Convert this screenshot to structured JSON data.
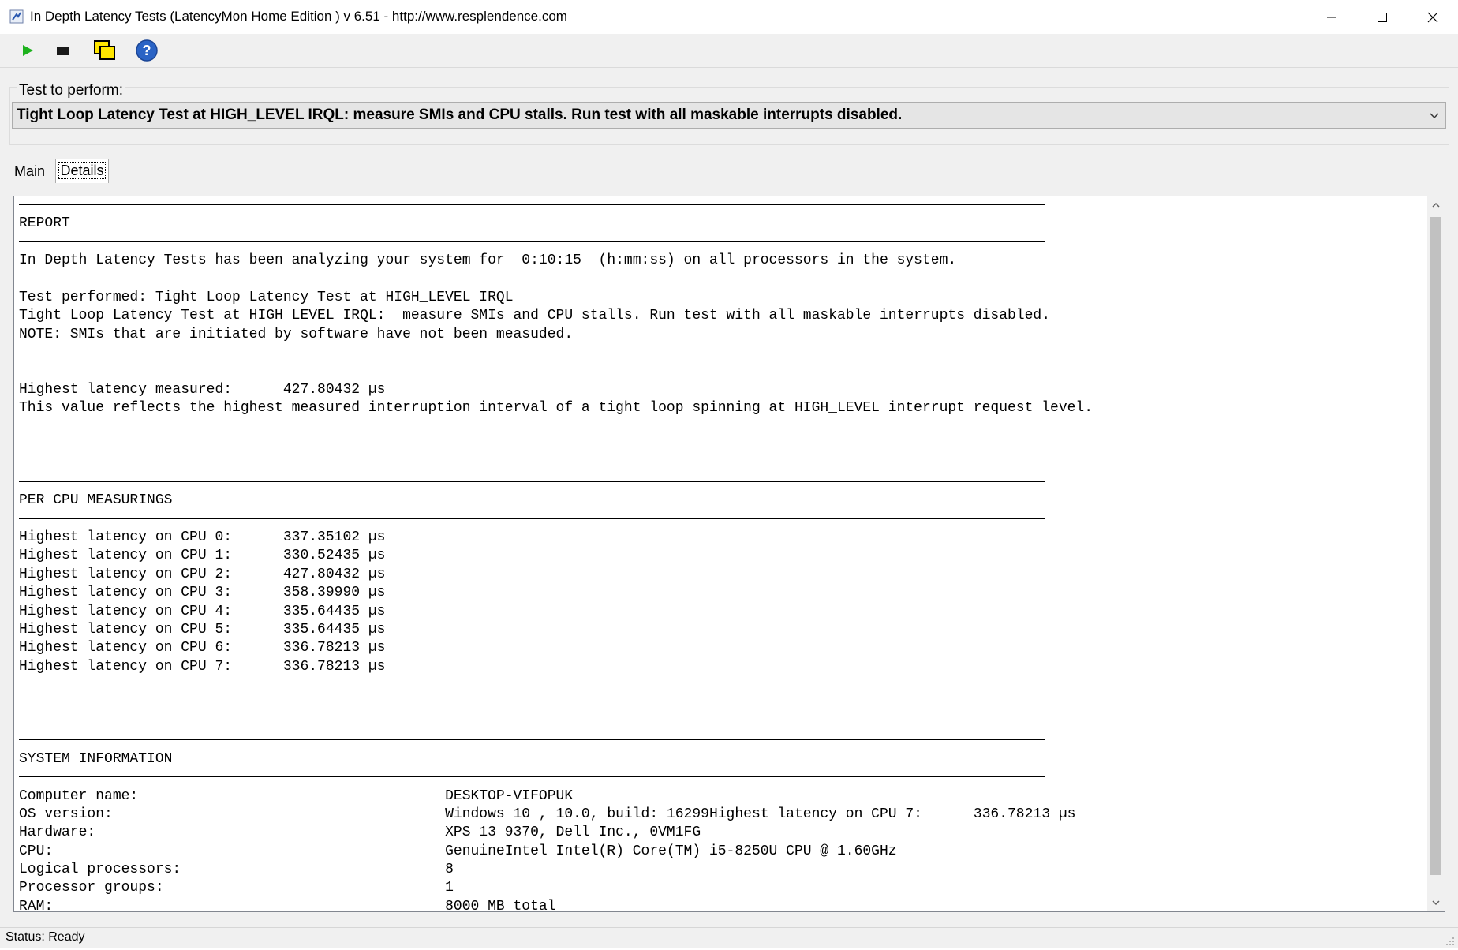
{
  "window": {
    "title": "In Depth Latency Tests  (LatencyMon Home Edition )  v 6.51 - http://www.resplendence.com"
  },
  "toolbar": {
    "buttons": [
      "play-icon",
      "stop-icon",
      "copy-windows-icon",
      "help-icon"
    ]
  },
  "test_group": {
    "label": "Test to perform:",
    "selected": "Tight Loop Latency Test at HIGH_LEVEL IRQL:  measure SMIs and CPU stalls. Run test with all maskable interrupts disabled."
  },
  "tabs": [
    {
      "label": "Main"
    },
    {
      "label": "Details"
    }
  ],
  "report": {
    "title": "REPORT",
    "analyzing": "In Depth Latency Tests has been analyzing your system for  0:10:15  (h:mm:ss) on all processors in the system.",
    "performed": "Test performed: Tight Loop Latency Test at HIGH_LEVEL IRQL",
    "description": "Tight Loop Latency Test at HIGH_LEVEL IRQL:  measure SMIs and CPU stalls. Run test with all maskable interrupts disabled.",
    "note": "NOTE: SMIs that are initiated by software have not been measuded.",
    "highest": "Highest latency measured:      427.80432 µs",
    "reflects": "This value reflects the highest measured interruption interval of a tight loop spinning at HIGH_LEVEL interrupt request level."
  },
  "per_cpu": {
    "title": "PER CPU MEASURINGS",
    "lines": [
      "Highest latency on CPU 0:      337.35102 µs",
      "Highest latency on CPU 1:      330.52435 µs",
      "Highest latency on CPU 2:      427.80432 µs",
      "Highest latency on CPU 3:      358.39990 µs",
      "Highest latency on CPU 4:      335.64435 µs",
      "Highest latency on CPU 5:      335.64435 µs",
      "Highest latency on CPU 6:      336.78213 µs",
      "Highest latency on CPU 7:      336.78213 µs"
    ]
  },
  "system_info": {
    "title": "SYSTEM INFORMATION",
    "lines": [
      "Computer name:                                    DESKTOP-VIFOPUK",
      "OS version:                                       Windows 10 , 10.0, build: 16299Highest latency on CPU 7:      336.78213 µs",
      "Hardware:                                         XPS 13 9370, Dell Inc., 0VM1FG",
      "CPU:                                              GenuineIntel Intel(R) Core(TM) i5-8250U CPU @ 1.60GHz",
      "Logical processors:                               8",
      "Processor groups:                                 1",
      "RAM:                                              8000 MB total"
    ]
  },
  "status": {
    "text": "Status: Ready"
  }
}
